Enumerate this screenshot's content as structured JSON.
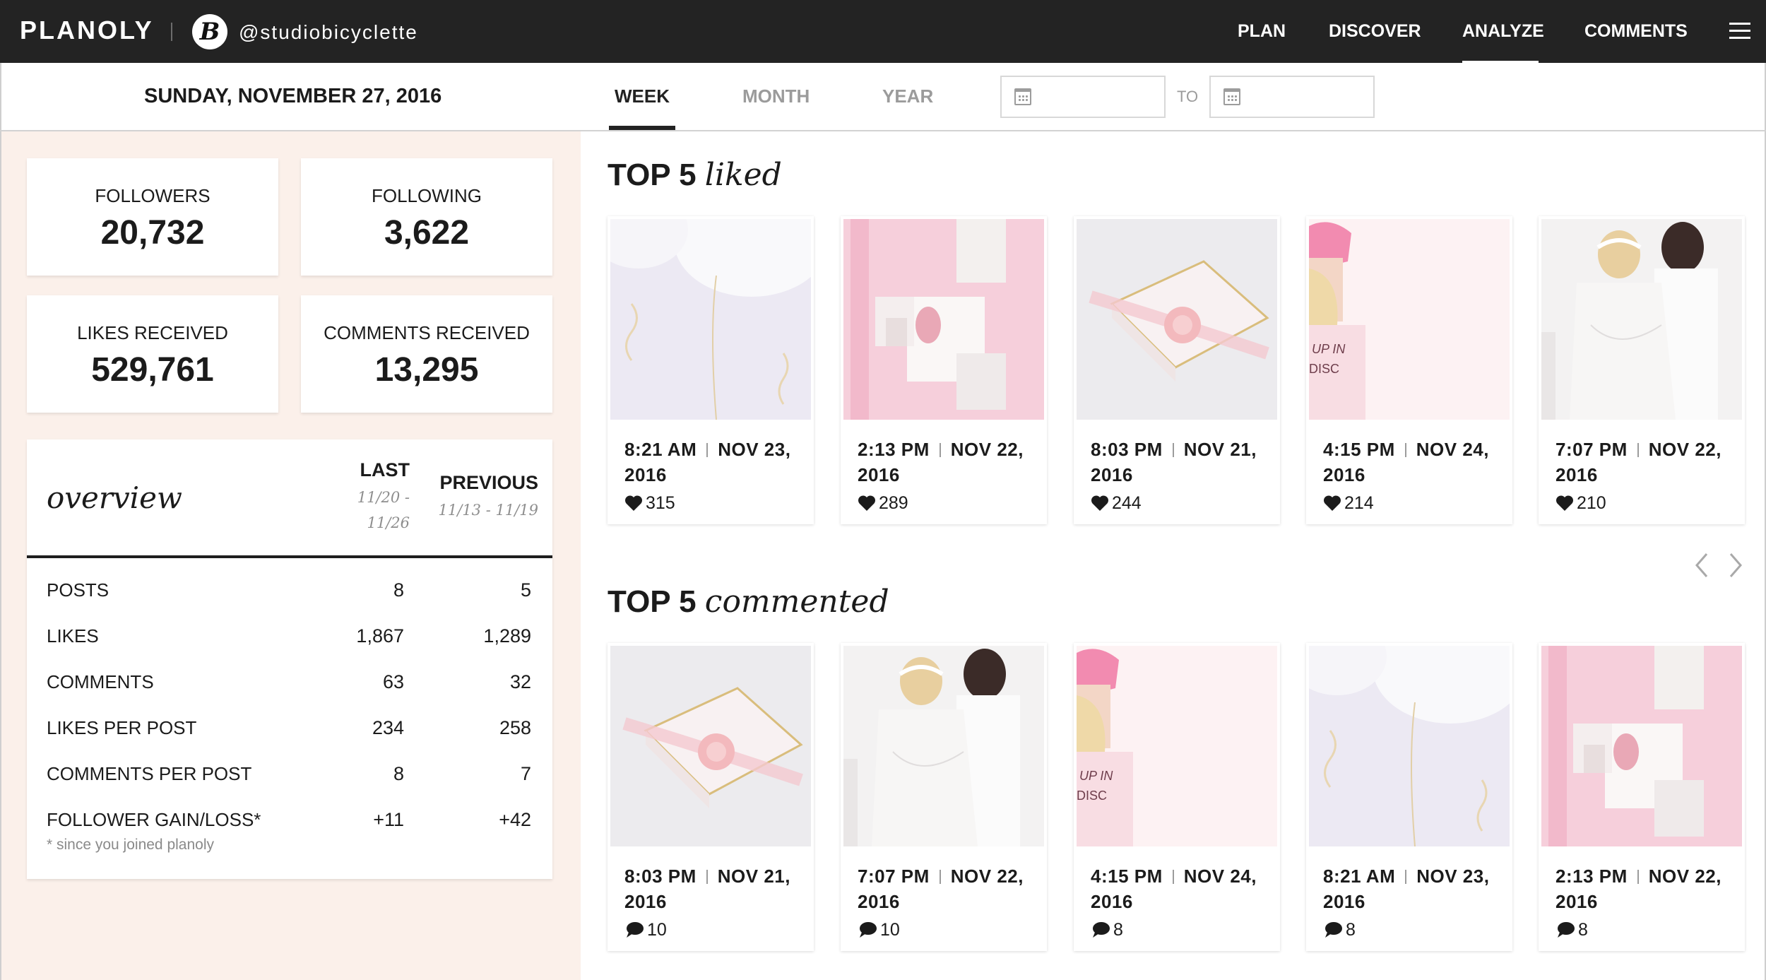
{
  "topbar": {
    "brand": "PLANOLY",
    "avatar_letter": "B",
    "handle": "@studiobicyclette",
    "nav": [
      "PLAN",
      "DISCOVER",
      "ANALYZE",
      "COMMENTS"
    ],
    "active_nav": "ANALYZE"
  },
  "subbar": {
    "date": "SUNDAY, NOVEMBER 27, 2016",
    "tabs": [
      "WEEK",
      "MONTH",
      "YEAR"
    ],
    "active_tab": "WEEK",
    "to_label": "TO",
    "from_value": "",
    "to_value": ""
  },
  "stats": {
    "followers": {
      "label": "FOLLOWERS",
      "value": "20,732"
    },
    "following": {
      "label": "FOLLOWING",
      "value": "3,622"
    },
    "likes_received": {
      "label": "LIKES RECEIVED",
      "value": "529,761"
    },
    "comments_received": {
      "label": "COMMENTS RECEIVED",
      "value": "13,295"
    }
  },
  "overview": {
    "title": "overview",
    "last_label": "LAST",
    "last_range_1": "11/20 -",
    "last_range_2": "11/26",
    "previous_label": "PREVIOUS",
    "previous_range": "11/13 - 11/19",
    "rows": [
      {
        "name": "POSTS",
        "last": "8",
        "previous": "5"
      },
      {
        "name": "LIKES",
        "last": "1,867",
        "previous": "1,289"
      },
      {
        "name": "COMMENTS",
        "last": "63",
        "previous": "32"
      },
      {
        "name": "LIKES PER POST",
        "last": "234",
        "previous": "258"
      },
      {
        "name": "COMMENTS PER POST",
        "last": "8",
        "previous": "7"
      },
      {
        "name": "FOLLOWER GAIN/LOSS*",
        "last": "+11",
        "previous": "+42"
      }
    ],
    "note": "* since you joined planoly"
  },
  "top_liked": {
    "title_bold": "TOP 5",
    "title_italic": "liked",
    "posts": [
      {
        "time": "8:21 AM",
        "date": "NOV 23,",
        "year": "2016",
        "metric": "315",
        "image": "balloons"
      },
      {
        "time": "2:13 PM",
        "date": "NOV 22,",
        "year": "2016",
        "metric": "289",
        "image": "pink-collage"
      },
      {
        "time": "8:03 PM",
        "date": "NOV 21,",
        "year": "2016",
        "metric": "244",
        "image": "gift-box"
      },
      {
        "time": "4:15 PM",
        "date": "NOV 24,",
        "year": "2016",
        "metric": "214",
        "image": "pink-beanie"
      },
      {
        "time": "7:07 PM",
        "date": "NOV 22,",
        "year": "2016",
        "metric": "210",
        "image": "brides"
      }
    ]
  },
  "top_commented": {
    "title_bold": "TOP 5",
    "title_italic": "commented",
    "posts": [
      {
        "time": "8:03 PM",
        "date": "NOV 21,",
        "year": "2016",
        "metric": "10",
        "image": "gift-box"
      },
      {
        "time": "7:07 PM",
        "date": "NOV 22,",
        "year": "2016",
        "metric": "10",
        "image": "brides"
      },
      {
        "time": "4:15 PM",
        "date": "NOV 24,",
        "year": "2016",
        "metric": "8",
        "image": "pink-beanie"
      },
      {
        "time": "8:21 AM",
        "date": "NOV 23,",
        "year": "2016",
        "metric": "8",
        "image": "balloons"
      },
      {
        "time": "2:13 PM",
        "date": "NOV 22,",
        "year": "2016",
        "metric": "8",
        "image": "pink-collage"
      }
    ]
  },
  "icons": {
    "like": "heart-icon",
    "comment": "speech-bubble-icon",
    "calendar": "calendar-icon",
    "menu": "hamburger-icon"
  }
}
